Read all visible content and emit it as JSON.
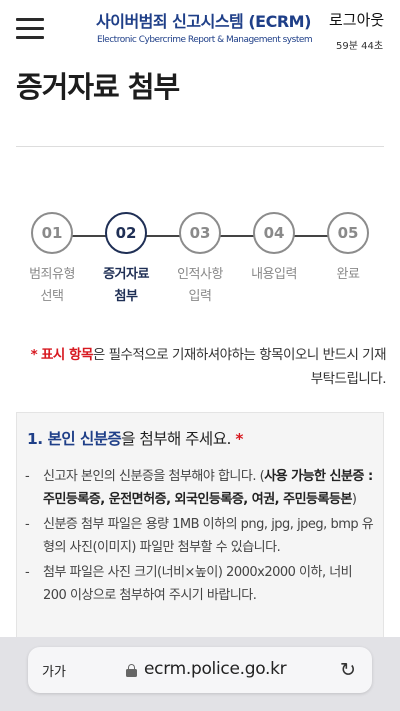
{
  "header": {
    "brand_title": "사이버범죄 신고시스템 (ECRM)",
    "brand_subtitle": "Electronic Cybercrime Report & Management system",
    "logout_label": "로그아웃",
    "session_timer": "59분 44초"
  },
  "page_title": "증거자료 첨부",
  "steps": [
    {
      "number": "01",
      "label": "범죄유형\n선택",
      "active": false
    },
    {
      "number": "02",
      "label": "증거자료\n첨부",
      "active": true
    },
    {
      "number": "03",
      "label": "인적사항\n입력",
      "active": false
    },
    {
      "number": "04",
      "label": "내용입력",
      "active": false
    },
    {
      "number": "05",
      "label": "완료",
      "active": false
    }
  ],
  "notice": {
    "star": "*",
    "required_mark": "표시 항목",
    "text": "은 필수적으로 기재하셔야하는 항목이오니 반드시 기재 부탁드립니다."
  },
  "card": {
    "title_number": "1. ",
    "title_emph": "본인 신분증",
    "title_rest": "을 첨부해 주세요. ",
    "title_star": "*",
    "bullets": [
      {
        "dash": "-",
        "text": "신고자 본인의 신분증을 첨부해야 합니다. (",
        "bold": "사용 가능한 신분증 : 주민등록증, 운전면허증, 외국인등록증, 여권, 주민등록등본",
        "tail": ")"
      },
      {
        "dash": "-",
        "text": "신분증 첨부 파일은 용량 1MB 이하의 png, jpg, jpeg, bmp 유형의 사진(이미지) 파일만 첨부할 수 있습니다."
      },
      {
        "dash": "-",
        "text": "첨부 파일은 사진 크기(너비×높이) 2000x2000 이하, 너비 200 이상으로 첨부하여 주시기 바랍니다."
      }
    ]
  },
  "browser": {
    "text_size_label": "가가",
    "url": "ecrm.police.go.kr",
    "reload_icon": "reload-icon",
    "lock_icon": "lock-icon"
  },
  "colors": {
    "brand": "#1f3f88",
    "active_step": "#1f2f55",
    "required": "#d71920",
    "inactive_step": "#8a8a8a"
  }
}
